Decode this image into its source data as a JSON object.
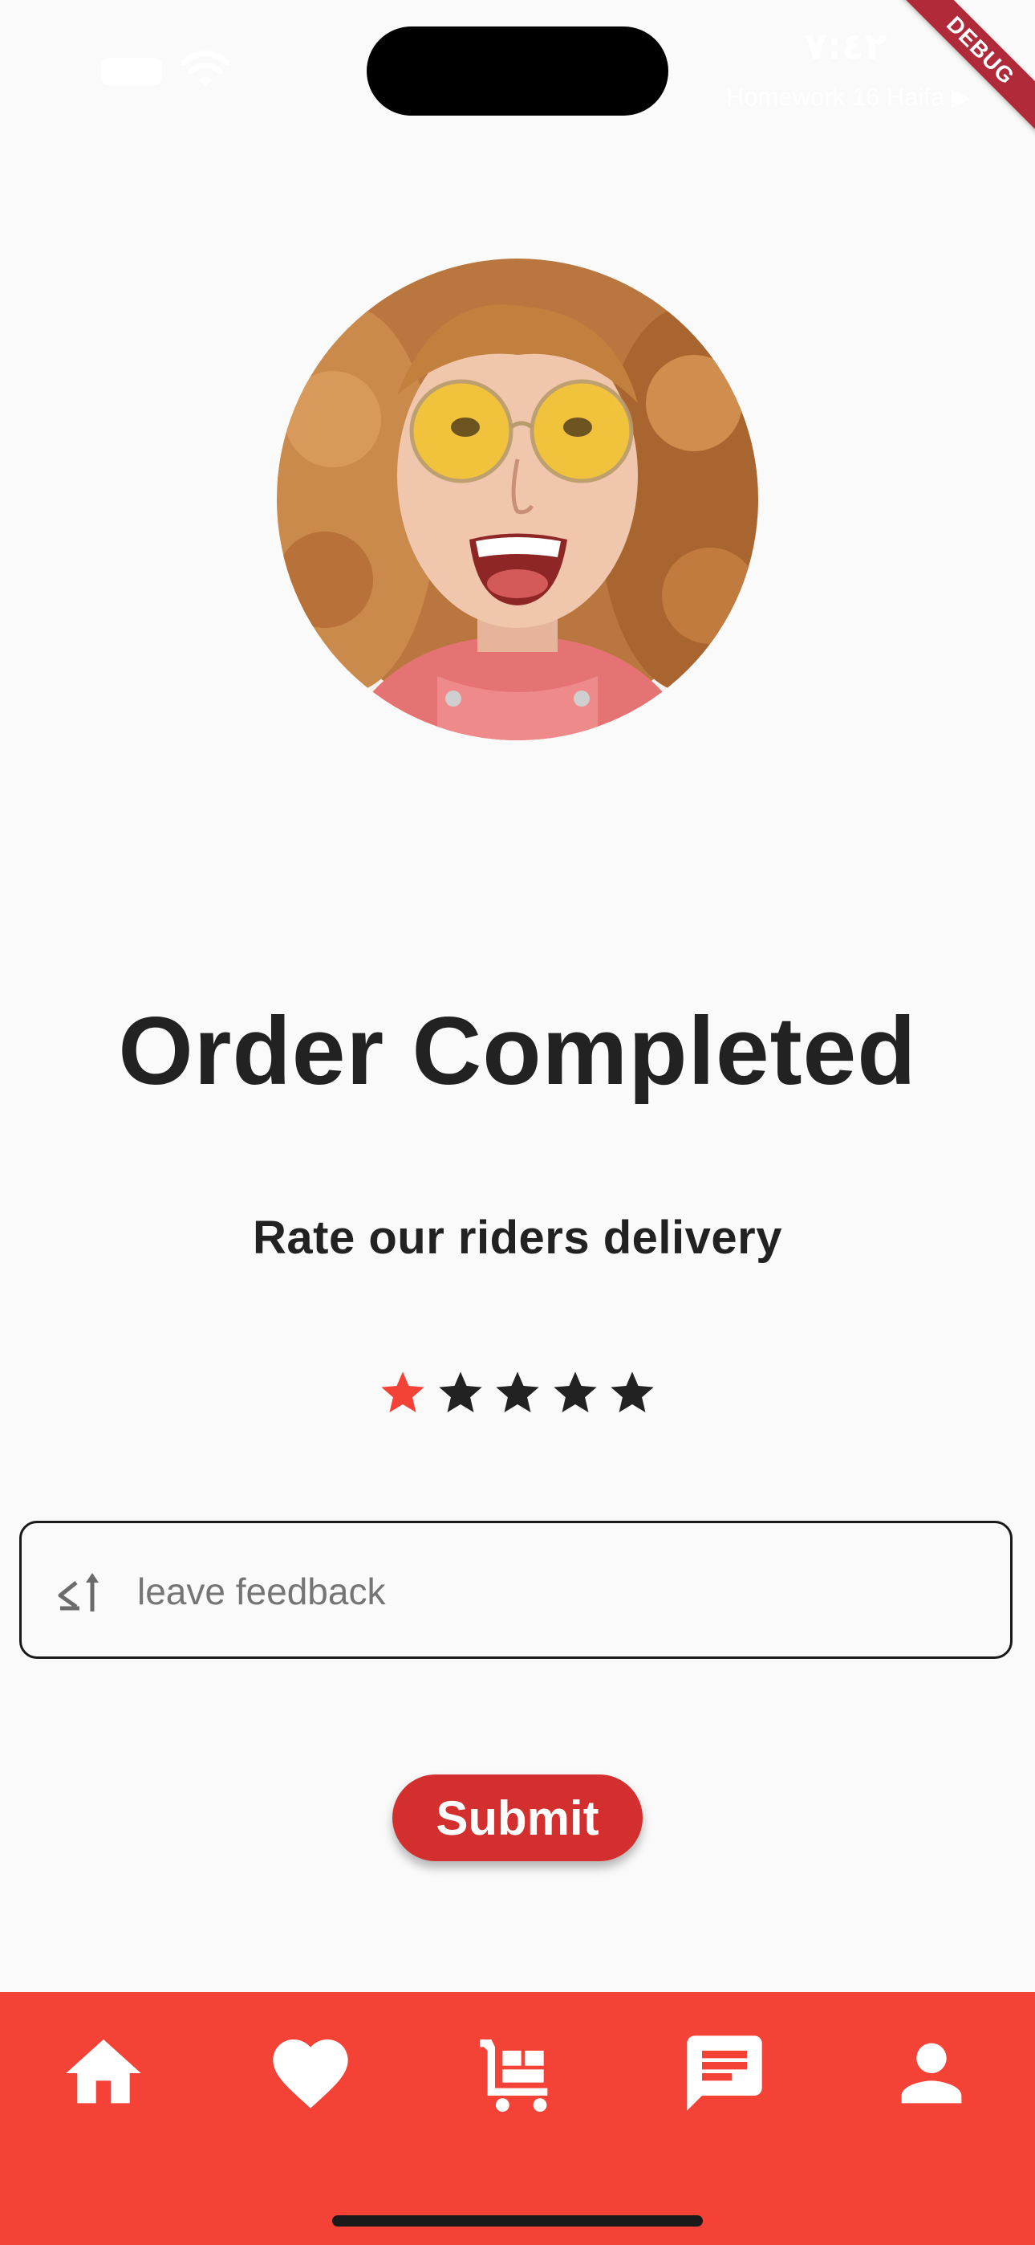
{
  "status_bar": {
    "time": "٧:٤٢",
    "back_app": "Homework 16 Haifa ▶",
    "debug_banner": "DEBUG",
    "icons": [
      "battery-icon",
      "wifi-icon"
    ]
  },
  "avatar": {
    "icon": "user-avatar-photo"
  },
  "title": "Order Completed",
  "subtitle": "Rate our riders delivery",
  "rating": {
    "value": 1,
    "max": 5,
    "active_color": "#f44336",
    "inactive_color": "#222222",
    "icon": "star-icon"
  },
  "feedback": {
    "placeholder": "leave feedback",
    "value": "",
    "icon": "text-direction-icon"
  },
  "submit_label": "Submit",
  "bottom_nav": {
    "background": "#f44336",
    "items": [
      {
        "name": "home",
        "icon": "home-icon"
      },
      {
        "name": "favorites",
        "icon": "heart-icon"
      },
      {
        "name": "cart",
        "icon": "cart-icon"
      },
      {
        "name": "messages",
        "icon": "chat-icon"
      },
      {
        "name": "profile",
        "icon": "person-icon"
      }
    ]
  },
  "colors": {
    "accent": "#f44336",
    "button": "#d32f2f",
    "text": "#222222",
    "background": "#fafafa"
  }
}
